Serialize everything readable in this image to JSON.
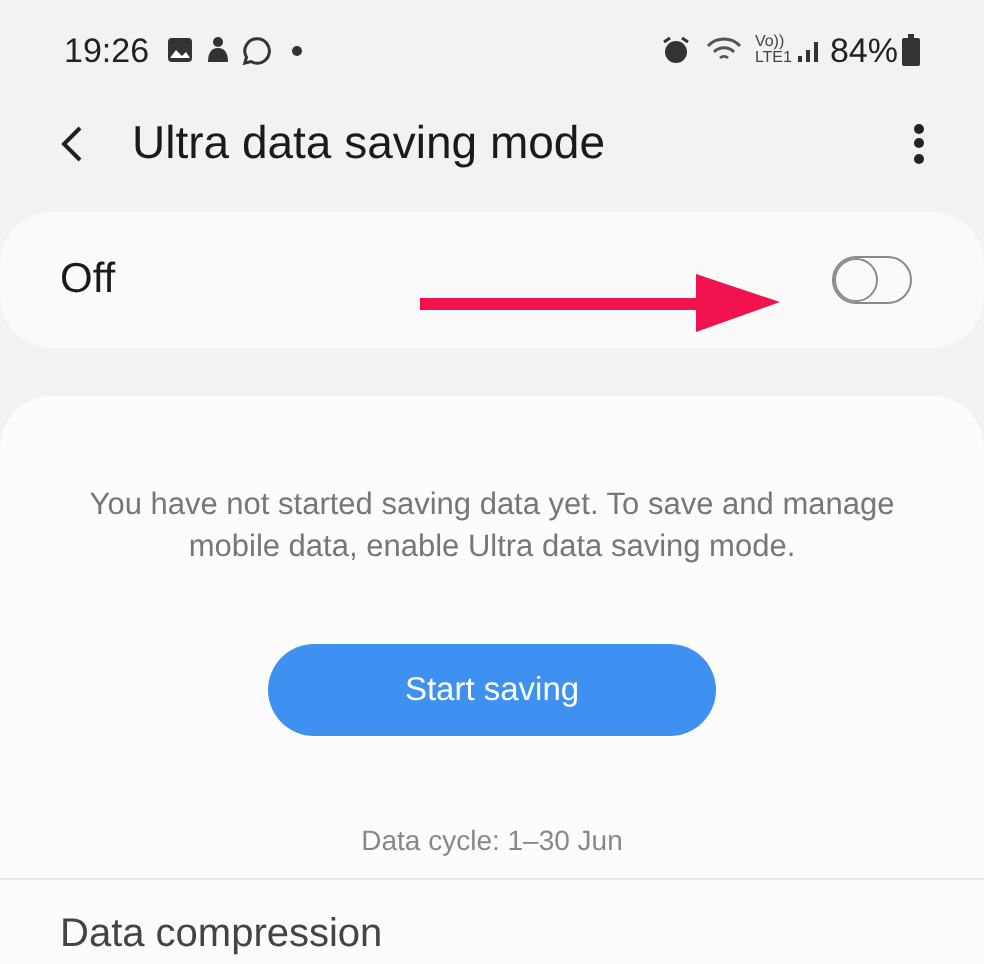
{
  "status_bar": {
    "time": "19:26",
    "volte_top": "Vo))",
    "volte_bottom": "LTE1",
    "battery": "84%"
  },
  "header": {
    "title": "Ultra data saving mode"
  },
  "master_switch": {
    "label": "Off",
    "on": false
  },
  "annotation": {
    "kind": "arrow",
    "color": "#f0134f"
  },
  "info_card": {
    "message": "You have not started saving data yet. To save and manage mobile data, enable Ultra data saving mode.",
    "button": "Start saving",
    "data_cycle": "Data cycle: 1–30 Jun"
  },
  "next_item": {
    "label": "Data compression"
  }
}
